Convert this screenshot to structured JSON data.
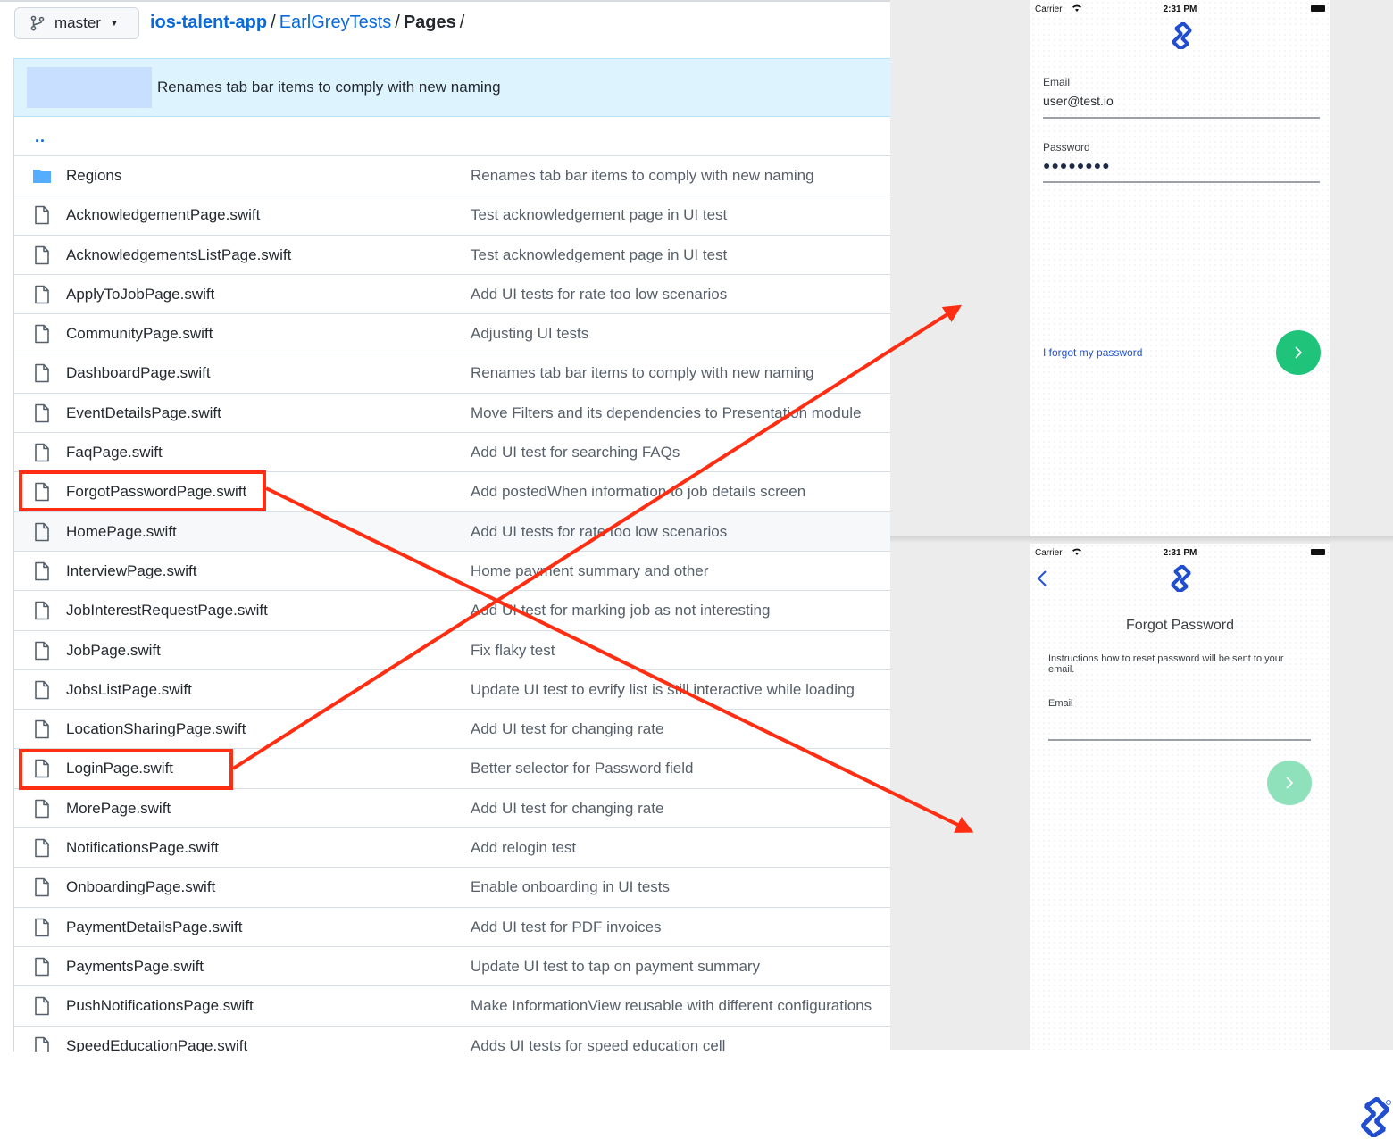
{
  "branch": {
    "name": "master"
  },
  "breadcrumb": {
    "repo": "ios-talent-app",
    "folder": "EarlGreyTests",
    "current": "Pages",
    "trailing_sep": "/"
  },
  "latest_commit": {
    "message": "Renames tab bar items to comply with new naming"
  },
  "parent_link": "..",
  "files": [
    {
      "name": "Regions",
      "type": "folder",
      "commit": "Renames tab bar items to comply with new naming"
    },
    {
      "name": "AcknowledgementPage.swift",
      "type": "file",
      "commit": "Test acknowledgement page in UI test"
    },
    {
      "name": "AcknowledgementsListPage.swift",
      "type": "file",
      "commit": "Test acknowledgement page in UI test"
    },
    {
      "name": "ApplyToJobPage.swift",
      "type": "file",
      "commit": "Add UI tests for rate too low scenarios"
    },
    {
      "name": "CommunityPage.swift",
      "type": "file",
      "commit": "Adjusting UI tests"
    },
    {
      "name": "DashboardPage.swift",
      "type": "file",
      "commit": "Renames tab bar items to comply with new naming"
    },
    {
      "name": "EventDetailsPage.swift",
      "type": "file",
      "commit": "Move Filters and its dependencies to Presentation module"
    },
    {
      "name": "FaqPage.swift",
      "type": "file",
      "commit": "Add UI test for searching FAQs"
    },
    {
      "name": "ForgotPasswordPage.swift",
      "type": "file",
      "commit": "Add postedWhen information to job details screen"
    },
    {
      "name": "HomePage.swift",
      "type": "file",
      "commit": "Add UI tests for rate too low scenarios"
    },
    {
      "name": "InterviewPage.swift",
      "type": "file",
      "commit": "Home payment summary and other"
    },
    {
      "name": "JobInterestRequestPage.swift",
      "type": "file",
      "commit": "Add UI test for marking job as not interesting"
    },
    {
      "name": "JobPage.swift",
      "type": "file",
      "commit": "Fix flaky test"
    },
    {
      "name": "JobsListPage.swift",
      "type": "file",
      "commit": "Update UI test to evrify list is still interactive while loading"
    },
    {
      "name": "LocationSharingPage.swift",
      "type": "file",
      "commit": "Add UI test for changing rate"
    },
    {
      "name": "LoginPage.swift",
      "type": "file",
      "commit": "Better selector for Password field"
    },
    {
      "name": "MorePage.swift",
      "type": "file",
      "commit": "Add UI test for changing rate"
    },
    {
      "name": "NotificationsPage.swift",
      "type": "file",
      "commit": "Add relogin test"
    },
    {
      "name": "OnboardingPage.swift",
      "type": "file",
      "commit": "Enable onboarding in UI tests"
    },
    {
      "name": "PaymentDetailsPage.swift",
      "type": "file",
      "commit": "Add UI test for PDF invoices"
    },
    {
      "name": "PaymentsPage.swift",
      "type": "file",
      "commit": "Update UI test to tap on payment summary"
    },
    {
      "name": "PushNotificationsPage.swift",
      "type": "file",
      "commit": "Make InformationView reusable with different configurations"
    },
    {
      "name": "SpeedEducationPage.swift",
      "type": "file",
      "commit": "Adds UI tests for speed education cell"
    }
  ],
  "login_screen": {
    "status": {
      "carrier": "Carrier",
      "time": "2:31 PM"
    },
    "email_label": "Email",
    "email_value": "user@test.io",
    "password_label": "Password",
    "password_mask": "●●●●●●●●",
    "forgot_link": "I forgot my password",
    "submit_color": "#1fc47a"
  },
  "forgot_screen": {
    "status": {
      "carrier": "Carrier",
      "time": "2:31 PM"
    },
    "title": "Forgot Password",
    "instructions": "Instructions how to reset password will be sent to your email.",
    "email_label": "Email",
    "submit_color": "#8fe1bb"
  },
  "colors": {
    "link": "#0969da",
    "annotation": "#ff2d12",
    "brand": "#204ecf"
  },
  "icons": {
    "branch": "git-branch-icon",
    "folder": "folder-icon",
    "file": "file-icon",
    "logo": "toptal-logo-icon",
    "back": "chevron-left-icon",
    "submit": "chevron-right-icon"
  }
}
